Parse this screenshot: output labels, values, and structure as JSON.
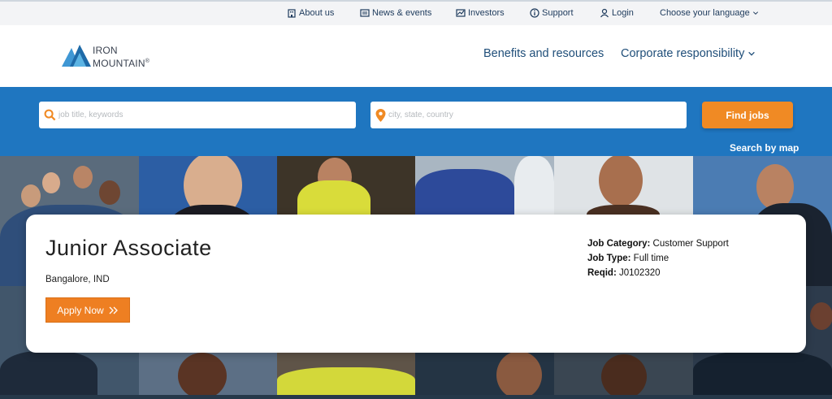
{
  "utility_nav": {
    "about": "About us",
    "news": "News & events",
    "investors": "Investors",
    "support": "Support",
    "login": "Login",
    "language": "Choose your language"
  },
  "brand": {
    "line1": "IRON",
    "line2": "MOUNTAIN",
    "mark": "®"
  },
  "main_nav": {
    "benefits": "Benefits and resources",
    "corporate": "Corporate responsibility"
  },
  "search": {
    "keywords_placeholder": "job title, keywords",
    "location_placeholder": "city, state, country",
    "find_label": "Find jobs",
    "map_link": "Search by map"
  },
  "job": {
    "title": "Junior Associate",
    "location": "Bangalore, IND",
    "apply_label": "Apply Now",
    "category_label": "Job Category:",
    "category_value": "Customer Support",
    "type_label": "Job Type:",
    "type_value": "Full time",
    "reqid_label": "Reqid:",
    "reqid_value": "J0102320"
  },
  "colors": {
    "search_band": "#1f76c0",
    "accent_orange": "#f08a24",
    "nav_blue": "#1f4e79"
  }
}
